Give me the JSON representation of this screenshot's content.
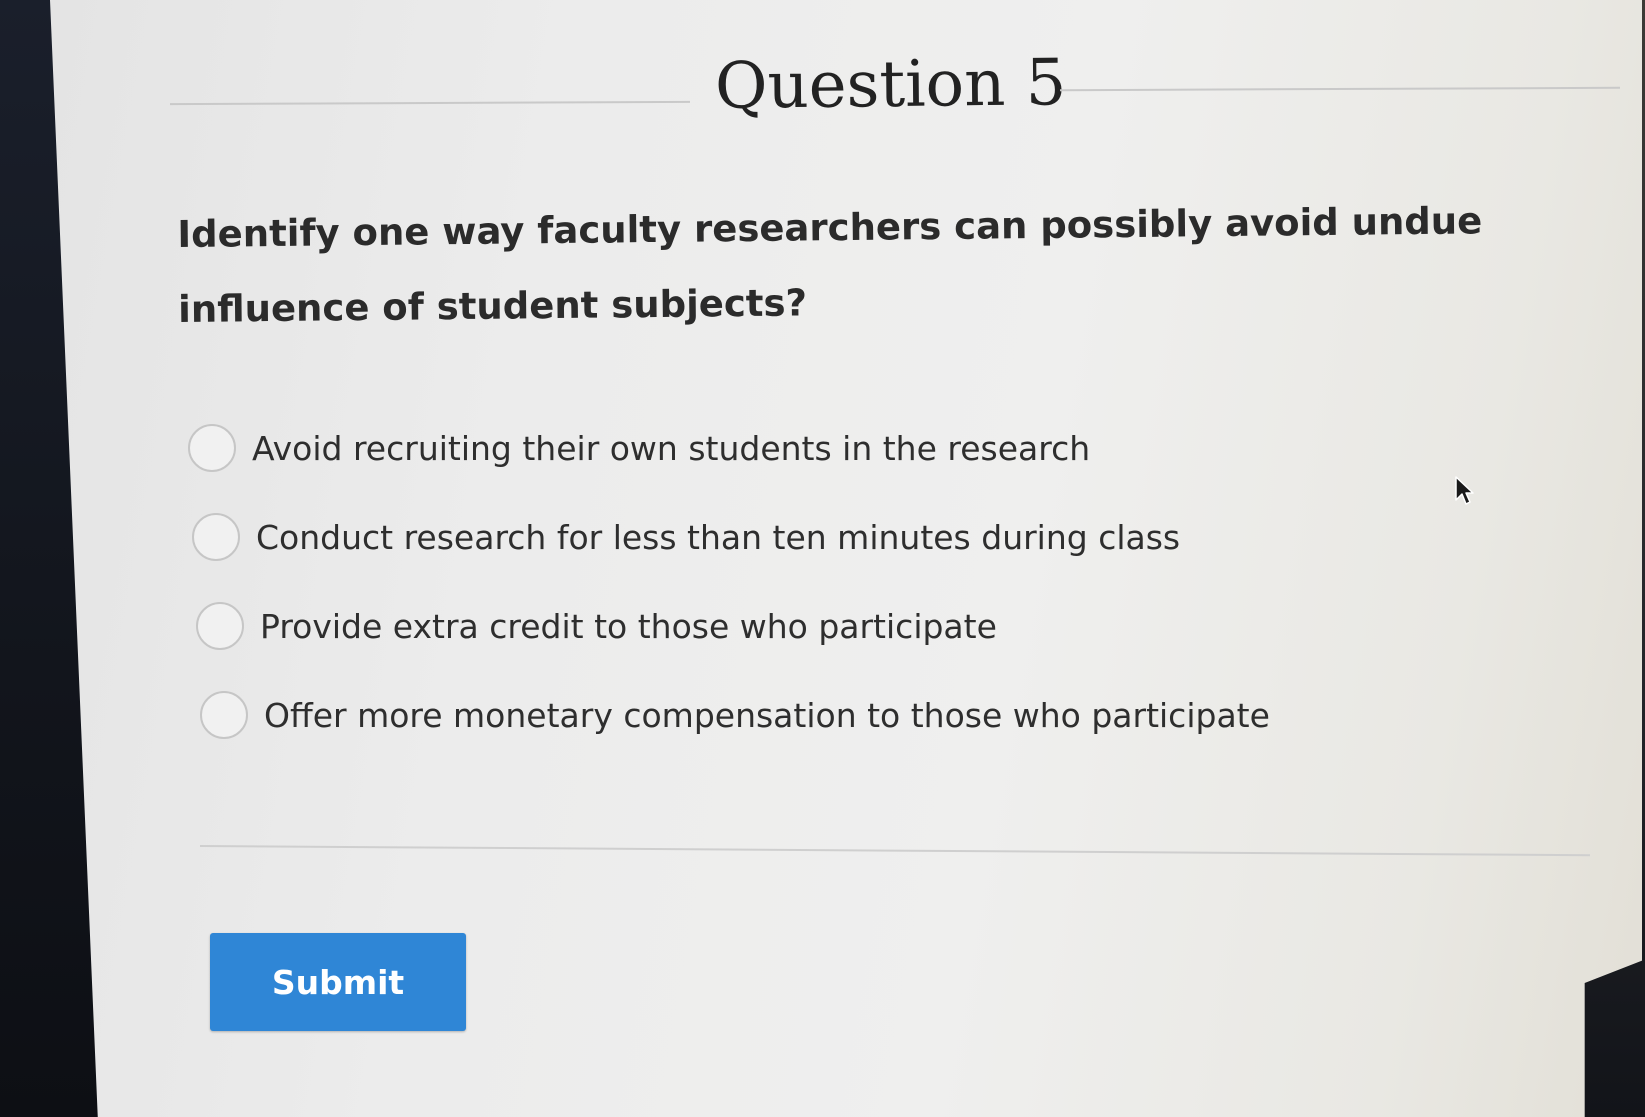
{
  "question": {
    "title": "Question 5",
    "text": "Identify one way faculty researchers can possibly avoid undue influence of student subjects?"
  },
  "options": [
    {
      "label": "Avoid recruiting their own students in the research",
      "selected": false
    },
    {
      "label": "Conduct research for less than ten minutes during class",
      "selected": false
    },
    {
      "label": "Provide extra credit to those who participate",
      "selected": false
    },
    {
      "label": "Offer more monetary compensation to those who participate",
      "selected": false
    }
  ],
  "actions": {
    "submit_label": "Submit"
  },
  "colors": {
    "submit_bg": "#2f86d6",
    "text": "#2b2b2b",
    "radio_border": "#c6c6c6"
  }
}
